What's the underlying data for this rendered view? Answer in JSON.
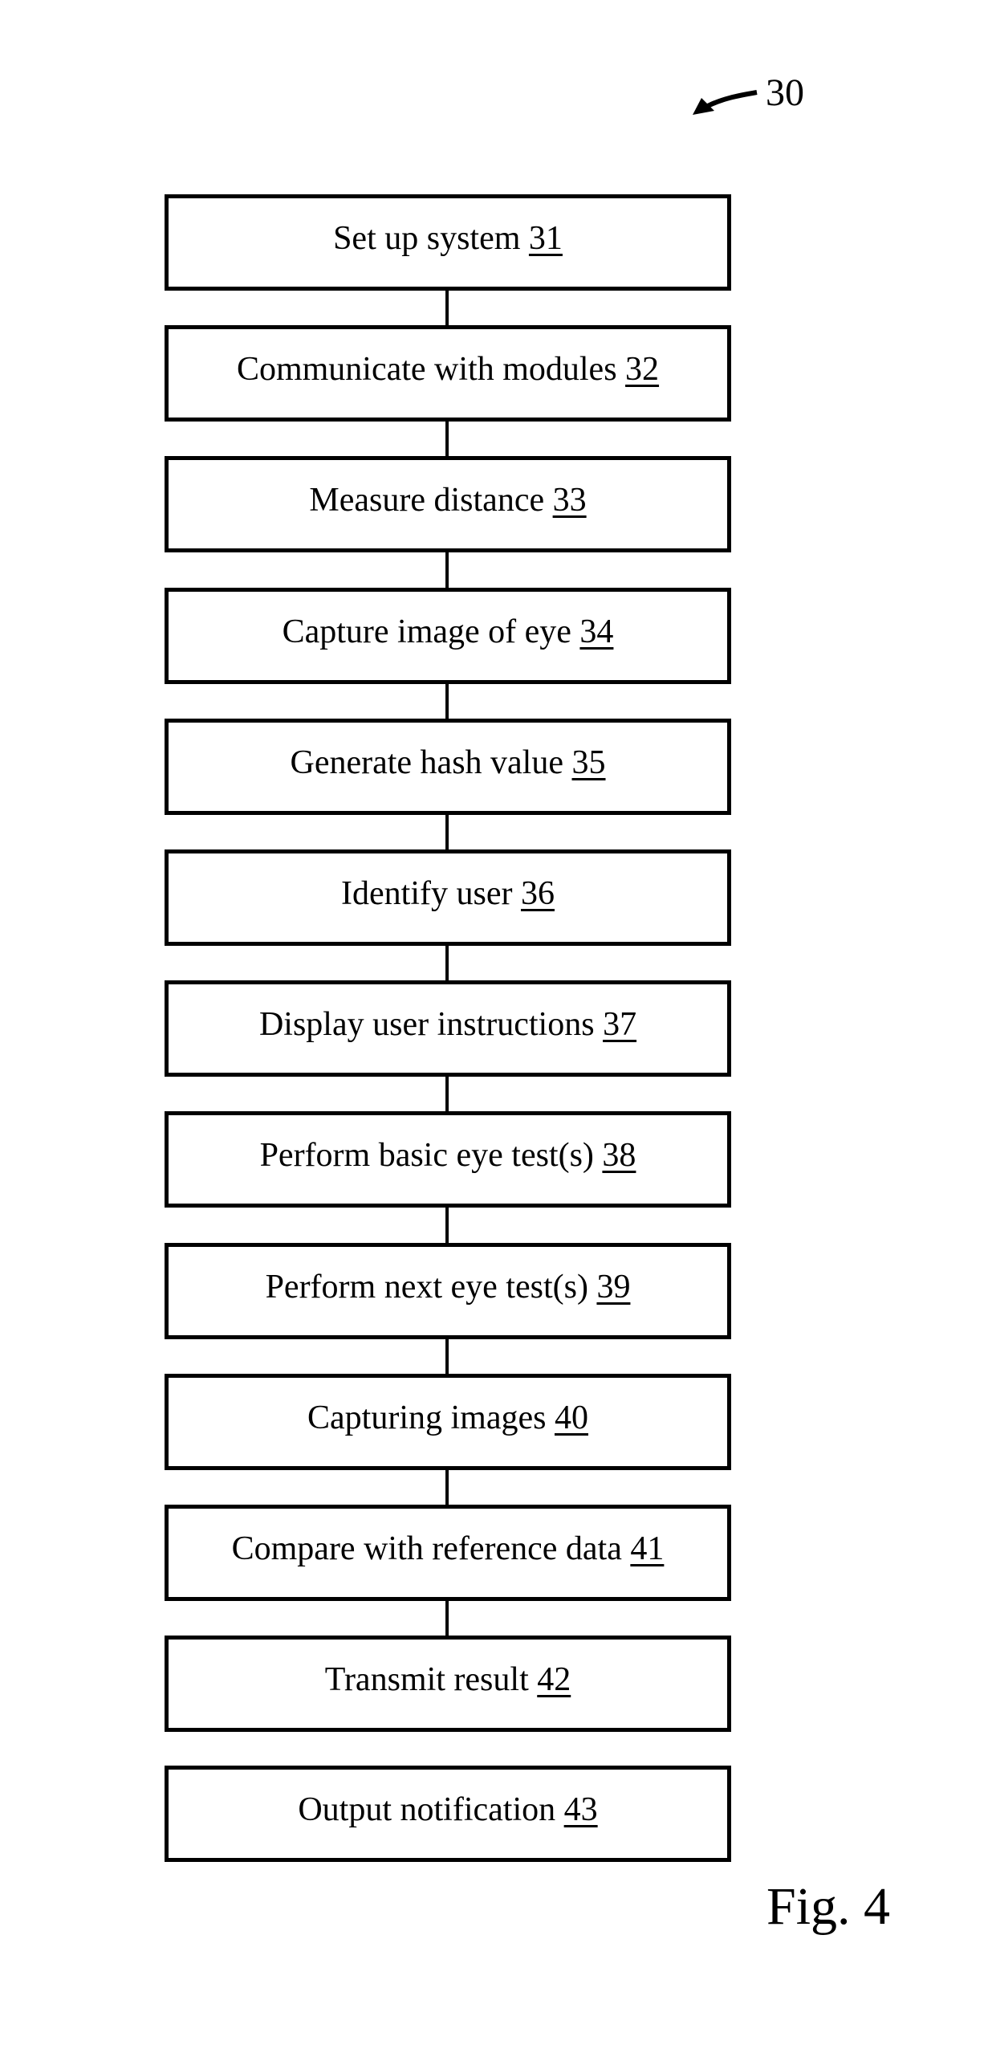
{
  "figure": {
    "reference_numeral": "30",
    "caption": "Fig. 4"
  },
  "steps": [
    {
      "label": "Set up system",
      "ref": "31",
      "connects_to_next": true
    },
    {
      "label": "Communicate with modules",
      "ref": "32",
      "connects_to_next": true
    },
    {
      "label": "Measure distance",
      "ref": "33",
      "connects_to_next": true
    },
    {
      "label": "Capture image of eye",
      "ref": "34",
      "connects_to_next": true
    },
    {
      "label": "Generate hash value",
      "ref": "35",
      "connects_to_next": true
    },
    {
      "label": "Identify user",
      "ref": "36",
      "connects_to_next": true
    },
    {
      "label": "Display user instructions",
      "ref": "37",
      "connects_to_next": true
    },
    {
      "label": "Perform basic eye test(s)",
      "ref": "38",
      "connects_to_next": true
    },
    {
      "label": "Perform next eye test(s)",
      "ref": "39",
      "connects_to_next": true
    },
    {
      "label": "Capturing images",
      "ref": "40",
      "connects_to_next": true
    },
    {
      "label": "Compare with reference data",
      "ref": "41",
      "connects_to_next": true
    },
    {
      "label": "Transmit result",
      "ref": "42",
      "connects_to_next": false
    },
    {
      "label": "Output notification",
      "ref": "43",
      "connects_to_next": false
    }
  ]
}
